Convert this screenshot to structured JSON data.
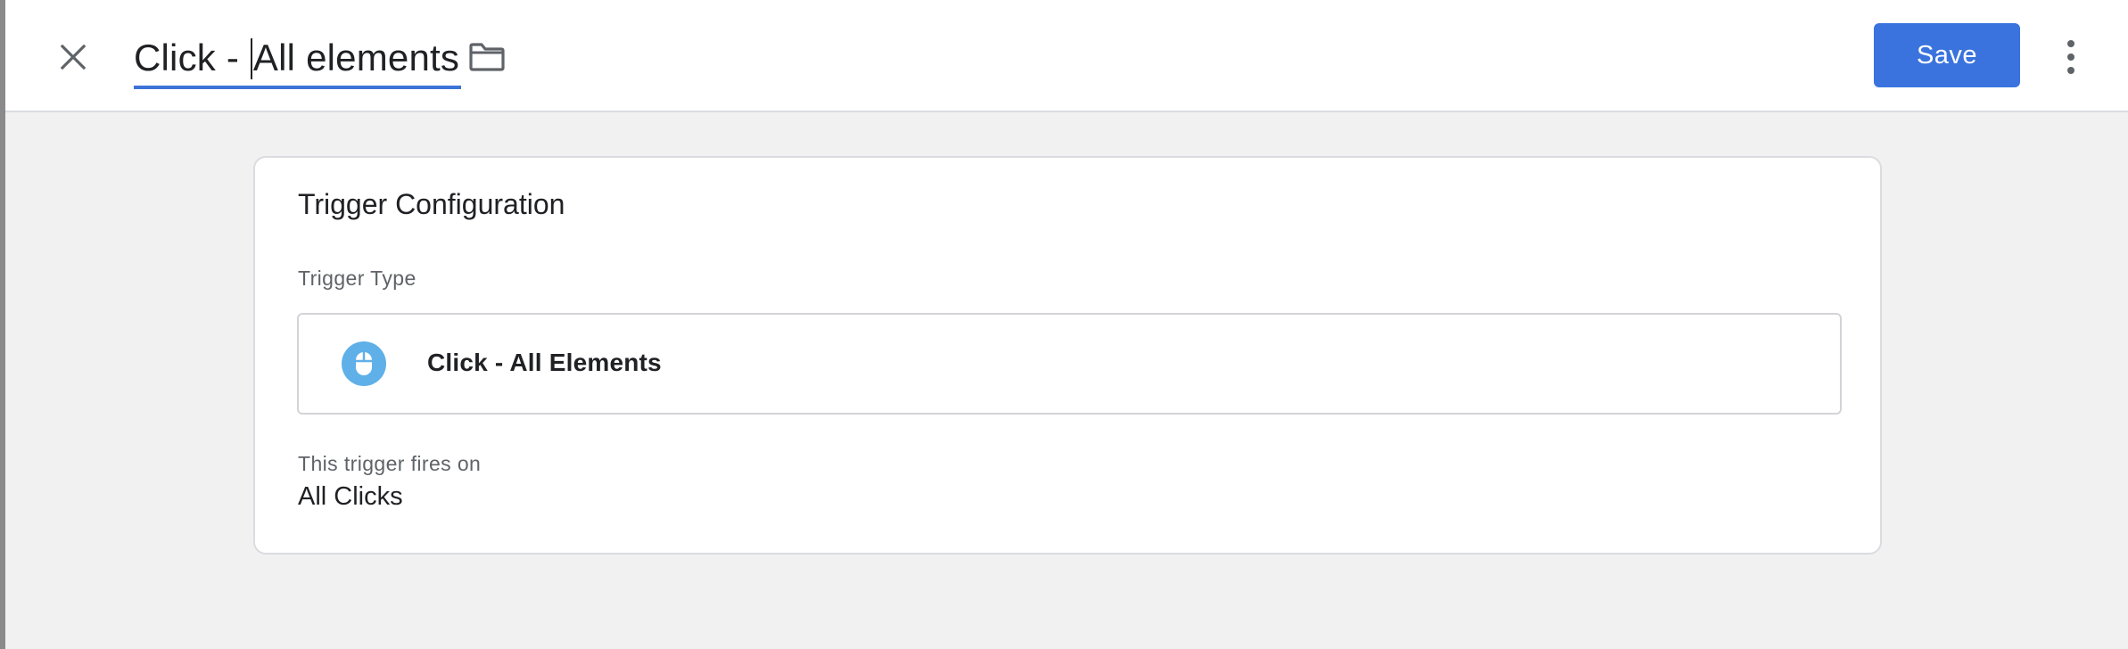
{
  "header": {
    "title_before_caret": "Click - ",
    "title_after_caret": "All elements",
    "close_icon": "close-icon",
    "folder_icon": "folder-icon",
    "save_label": "Save",
    "more_icon": "more-vert-icon",
    "accent_color": "#3a73dd",
    "underline_color": "#3b73d9"
  },
  "card": {
    "title": "Trigger Configuration",
    "trigger_type_label": "Trigger Type",
    "trigger_type": {
      "icon": "mouse-icon",
      "icon_color": "#5fb0e8",
      "name": "Click - All Elements"
    },
    "fires_on_label": "This trigger fires on",
    "fires_on_value": "All Clicks"
  }
}
